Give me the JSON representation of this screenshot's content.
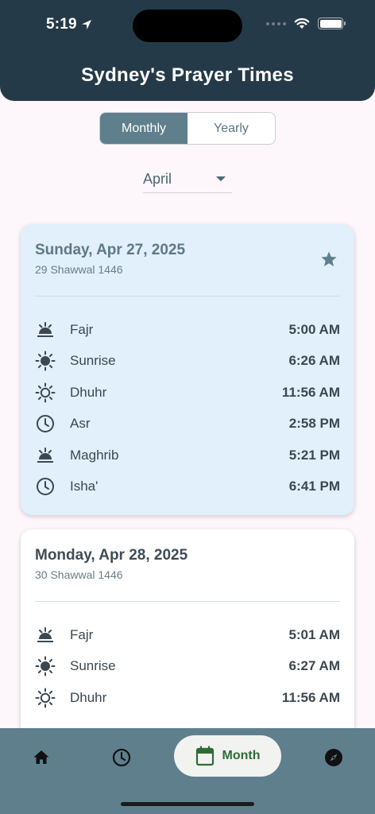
{
  "status_bar": {
    "time": "5:19"
  },
  "header": {
    "title": "Sydney's Prayer Times"
  },
  "view_toggle": {
    "options": [
      "Monthly",
      "Yearly"
    ],
    "selected": "Monthly"
  },
  "month_select": {
    "value": "April"
  },
  "days": [
    {
      "date": "Sunday, Apr 27, 2025",
      "hijri": "29 Shawwal 1446",
      "favorite": true,
      "prayers": [
        {
          "name": "Fajr",
          "time": "5:00 AM",
          "icon": "sunrise-icon"
        },
        {
          "name": "Sunrise",
          "time": "6:26 AM",
          "icon": "sun-filled-icon"
        },
        {
          "name": "Dhuhr",
          "time": "11:56 AM",
          "icon": "sun-outline-icon"
        },
        {
          "name": "Asr",
          "time": "2:58 PM",
          "icon": "clock-icon"
        },
        {
          "name": "Maghrib",
          "time": "5:21 PM",
          "icon": "sunset-icon"
        },
        {
          "name": "Isha'",
          "time": "6:41 PM",
          "icon": "clock-icon"
        }
      ]
    },
    {
      "date": "Monday, Apr 28, 2025",
      "hijri": "30 Shawwal 1446",
      "favorite": false,
      "prayers": [
        {
          "name": "Fajr",
          "time": "5:01 AM",
          "icon": "sunrise-icon"
        },
        {
          "name": "Sunrise",
          "time": "6:27 AM",
          "icon": "sun-filled-icon"
        },
        {
          "name": "Dhuhr",
          "time": "11:56 AM",
          "icon": "sun-outline-icon"
        }
      ]
    }
  ],
  "bottom_nav": {
    "items": [
      {
        "icon": "home-icon"
      },
      {
        "icon": "clock-icon"
      },
      {
        "icon": "calendar-icon",
        "label": "Month",
        "active": true
      },
      {
        "icon": "compass-icon"
      }
    ]
  },
  "colors": {
    "header_bg": "#253a48",
    "accent": "#5f7f8d",
    "highlight_card": "#e1f0fb",
    "active_nav_text": "#2f6b37"
  }
}
